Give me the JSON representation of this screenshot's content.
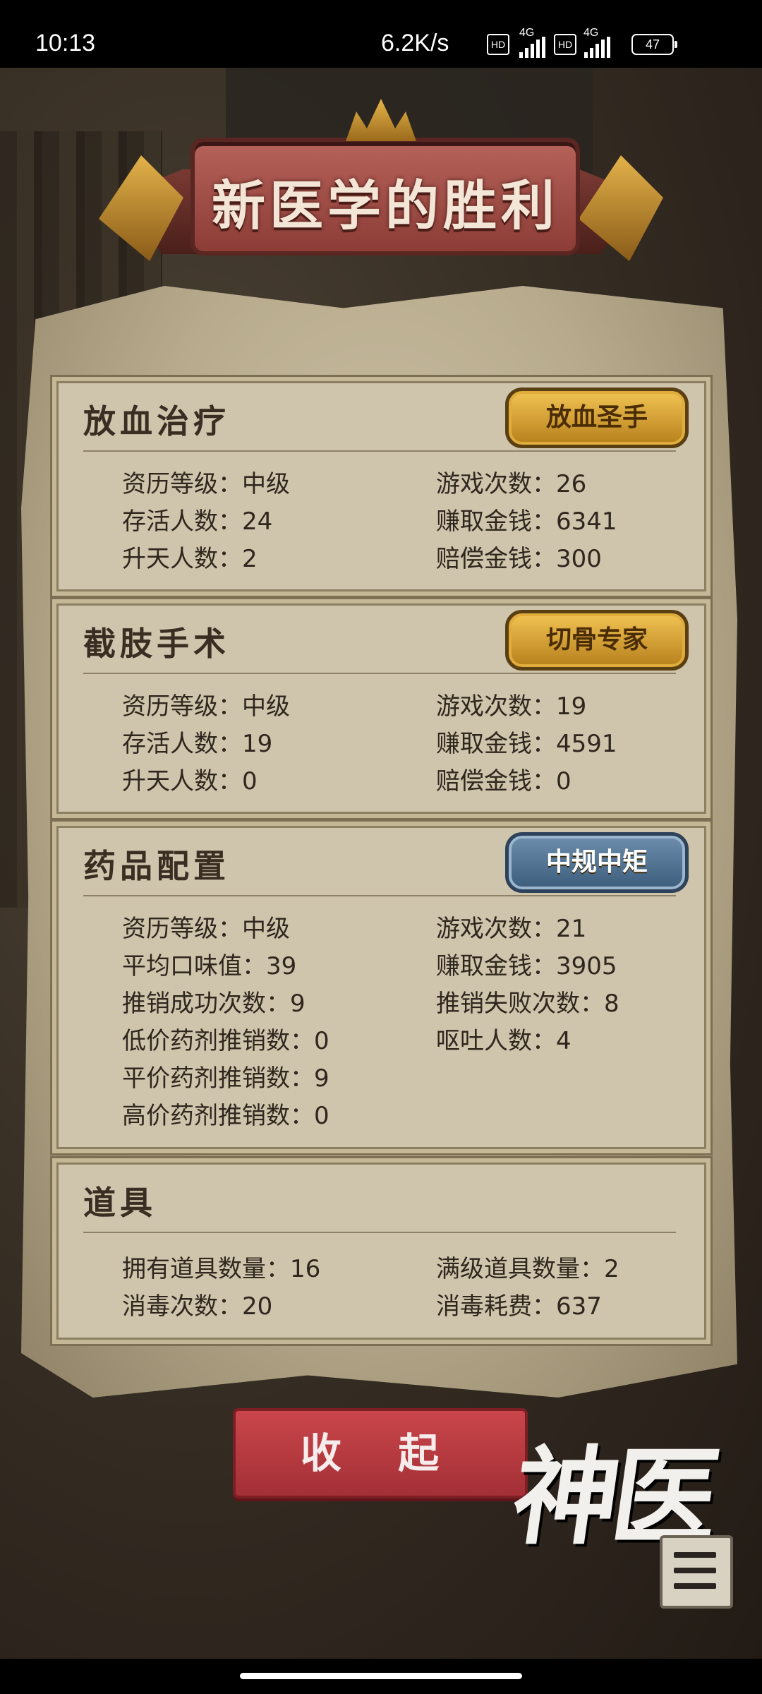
{
  "status_bar": {
    "time": "10:13",
    "net_speed": "6.2K/s",
    "hd_label": "HD",
    "network_type": "4G",
    "battery": "47"
  },
  "title": "新医学的胜利",
  "sections": [
    {
      "title": "放血治疗",
      "badge": "放血圣手",
      "badge_style": "gold",
      "stats_left": [
        "资历等级：中级",
        "存活人数：24",
        "升天人数：2"
      ],
      "stats_right": [
        "游戏次数：26",
        "赚取金钱：6341",
        "赔偿金钱：300"
      ]
    },
    {
      "title": "截肢手术",
      "badge": "切骨专家",
      "badge_style": "gold",
      "stats_left": [
        "资历等级：中级",
        "存活人数：19",
        "升天人数：0"
      ],
      "stats_right": [
        "游戏次数：19",
        "赚取金钱：4591",
        "赔偿金钱：0"
      ]
    },
    {
      "title": "药品配置",
      "badge": "中规中矩",
      "badge_style": "blue",
      "stats_left": [
        "资历等级：中级",
        "平均口味值：39",
        "推销成功次数：9",
        "低价药剂推销数：0",
        "平价药剂推销数：9",
        "高价药剂推销数：0"
      ],
      "stats_right": [
        "游戏次数：21",
        "赚取金钱：3905",
        "推销失败次数：8",
        "呕吐人数：4"
      ]
    },
    {
      "title": "道具",
      "stats_left": [
        "拥有道具数量：16",
        "消毒次数：20"
      ],
      "stats_right": [
        "满级道具数量：2",
        "消毒耗费：637"
      ]
    }
  ],
  "collapse_button": "收 起",
  "logo_text": "神医",
  "colors": {
    "banner_red": "#a5504a",
    "button_red": "#c0404a",
    "badge_gold": "#d9a034",
    "badge_blue": "#4f7090",
    "parchment": "#cfc5ad"
  }
}
